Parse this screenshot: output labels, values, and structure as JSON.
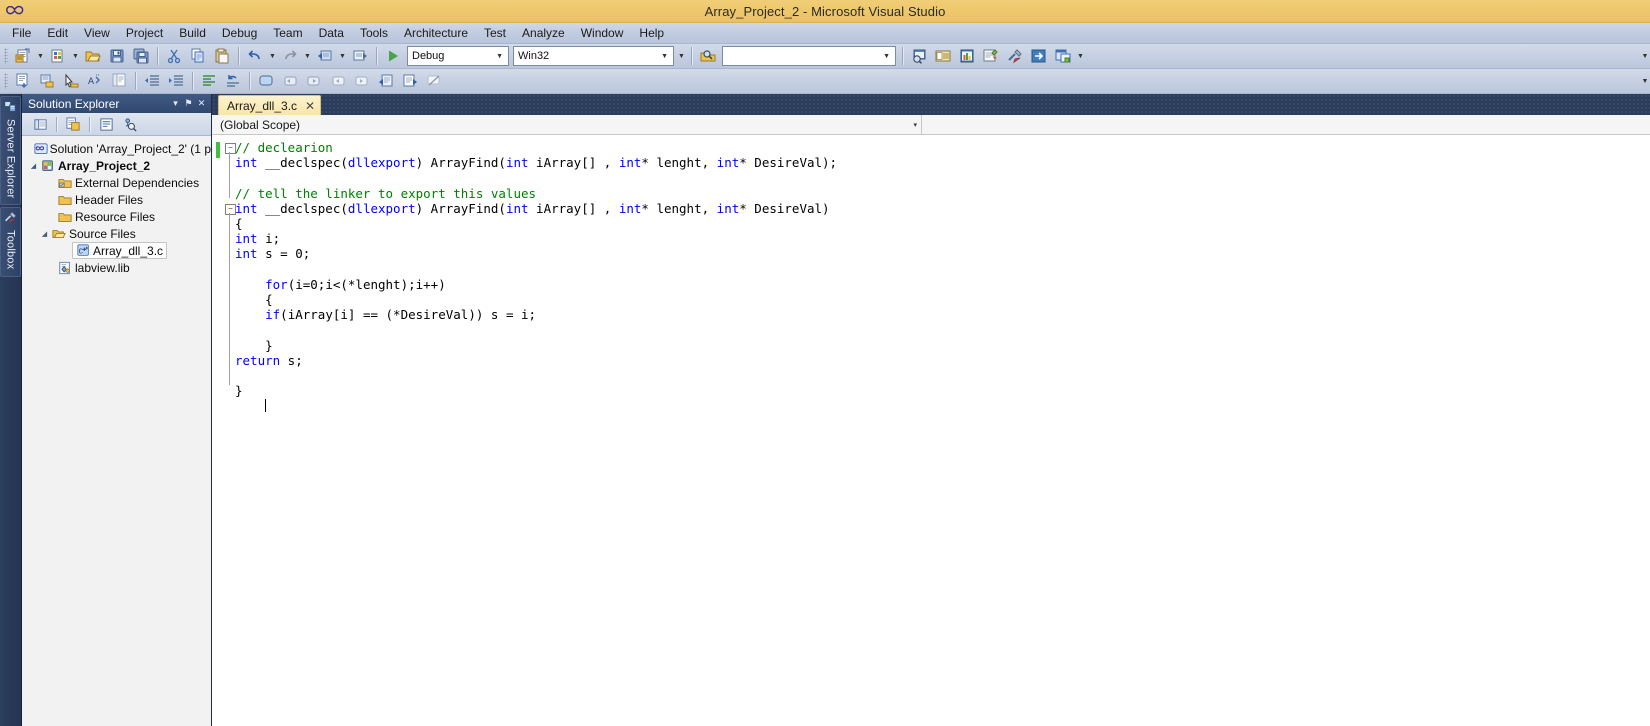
{
  "window": {
    "title": "Array_Project_2 - Microsoft Visual Studio",
    "logo_icon": "visual-studio-infinity-logo"
  },
  "menubar": {
    "items": [
      {
        "label": "File"
      },
      {
        "label": "Edit"
      },
      {
        "label": "View"
      },
      {
        "label": "Project"
      },
      {
        "label": "Build"
      },
      {
        "label": "Debug"
      },
      {
        "label": "Team"
      },
      {
        "label": "Data"
      },
      {
        "label": "Tools"
      },
      {
        "label": "Architecture"
      },
      {
        "label": "Test"
      },
      {
        "label": "Analyze"
      },
      {
        "label": "Window"
      },
      {
        "label": "Help"
      }
    ]
  },
  "toolbar_standard": {
    "config_combo": {
      "value": "Debug"
    },
    "platform_combo": {
      "value": "Win32"
    },
    "find_combo": {
      "value": "",
      "placeholder": ""
    },
    "overflow_label": "»"
  },
  "solution_explorer": {
    "title": "Solution Explorer",
    "header_buttons": [
      {
        "name": "window-dropdown-icon",
        "glyph": "▾"
      },
      {
        "name": "pin-icon",
        "glyph": "⚑"
      },
      {
        "name": "close-icon",
        "glyph": "✕"
      }
    ],
    "tree": [
      {
        "label": "Solution 'Array_Project_2' (1 p",
        "icon": "solution-icon",
        "indent": 0,
        "expander": "",
        "bold": false,
        "selected": false
      },
      {
        "label": "Array_Project_2",
        "icon": "project-icon",
        "indent": 1,
        "expander": "◢",
        "bold": true,
        "selected": false
      },
      {
        "label": "External Dependencies",
        "icon": "folder-dependencies-icon",
        "indent": 2,
        "expander": "",
        "bold": false,
        "selected": false
      },
      {
        "label": "Header Files",
        "icon": "folder-icon",
        "indent": 2,
        "expander": "",
        "bold": false,
        "selected": false
      },
      {
        "label": "Resource Files",
        "icon": "folder-icon",
        "indent": 2,
        "expander": "",
        "bold": false,
        "selected": false
      },
      {
        "label": "Source Files",
        "icon": "folder-open-icon",
        "indent": 2,
        "expander": "◢",
        "bold": false,
        "selected": false
      },
      {
        "label": "Array_dll_3.c",
        "icon": "c-file-icon",
        "indent": 3,
        "expander": "",
        "bold": false,
        "selected": true
      },
      {
        "label": "labview.lib",
        "icon": "lib-file-icon",
        "indent": 2,
        "expander": "",
        "bold": false,
        "selected": false
      }
    ]
  },
  "vertical_dock": {
    "tabs": [
      {
        "label": "Server Explorer",
        "icon": "server-explorer-icon"
      },
      {
        "label": "Toolbox",
        "icon": "toolbox-icon"
      }
    ]
  },
  "editor": {
    "tab": {
      "label": "Array_dll_3.c",
      "close_glyph": "✕"
    },
    "scope": {
      "value": "(Global Scope)",
      "arrow_glyph": "▾"
    },
    "code_lines": [
      {
        "n": 1,
        "text": "// declearion",
        "kind": "comment"
      },
      {
        "n": 2,
        "text": "int __declspec(dllexport) ArrayFind(int iArray[] , int* lenght, int* DesireVal);",
        "kind": "code"
      },
      {
        "n": 3,
        "text": "",
        "kind": "blank"
      },
      {
        "n": 4,
        "text": "// tell the linker to export this values",
        "kind": "comment"
      },
      {
        "n": 5,
        "text": "int __declspec(dllexport) ArrayFind(int iArray[] , int* lenght, int* DesireVal)",
        "kind": "code"
      },
      {
        "n": 6,
        "text": "{",
        "kind": "code"
      },
      {
        "n": 7,
        "text": "int i;",
        "kind": "code"
      },
      {
        "n": 8,
        "text": "int s = 0;",
        "kind": "code"
      },
      {
        "n": 9,
        "text": "",
        "kind": "blank"
      },
      {
        "n": 10,
        "text": "    for(i=0;i<(*lenght);i++)",
        "kind": "code"
      },
      {
        "n": 11,
        "text": "    {",
        "kind": "code"
      },
      {
        "n": 12,
        "text": "    if(iArray[i] == (*DesireVal)) s = i;",
        "kind": "code"
      },
      {
        "n": 13,
        "text": "",
        "kind": "blank"
      },
      {
        "n": 14,
        "text": "    }",
        "kind": "code"
      },
      {
        "n": 15,
        "text": "return s;",
        "kind": "code"
      },
      {
        "n": 16,
        "text": "",
        "kind": "blank"
      },
      {
        "n": 17,
        "text": "}",
        "kind": "code"
      },
      {
        "n": 18,
        "text": "    ",
        "kind": "caret"
      }
    ]
  },
  "colors": {
    "title_bar": "#eec86b",
    "menu_bar": "#c3cde1",
    "dock_blue": "#2c3c5b",
    "tab_active": "#f7e6a8",
    "keyword": "#0000ff",
    "comment": "#008000",
    "change_bar_green": "#3cc23c"
  }
}
